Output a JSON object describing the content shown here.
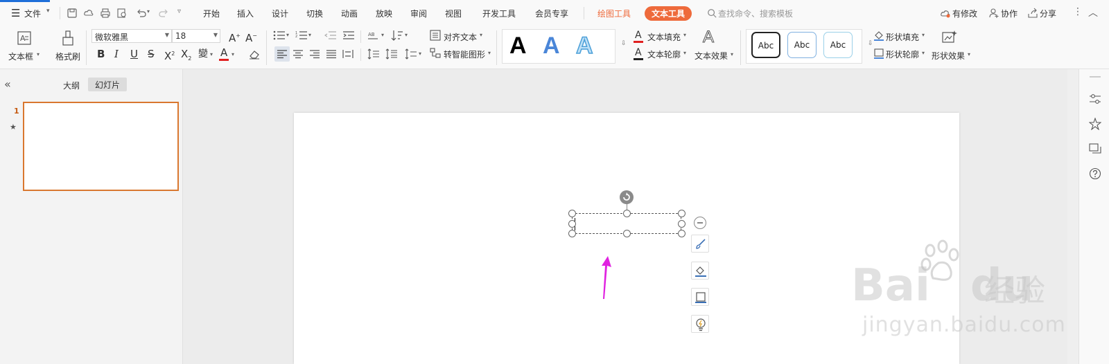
{
  "menu": {
    "file": "文件",
    "tabs": [
      "开始",
      "插入",
      "设计",
      "切换",
      "动画",
      "放映",
      "审阅",
      "视图",
      "开发工具",
      "会员专享"
    ],
    "drawing_tools": "绘图工具",
    "text_tools": "文本工具",
    "search_placeholder": "查找命令、搜索模板",
    "has_changes": "有修改",
    "collaborate": "协作",
    "share": "分享"
  },
  "ribbon": {
    "textbox": "文本框",
    "format_painter": "格式刷",
    "font_name": "微软雅黑",
    "font_size": "18",
    "align_text": "对齐文本",
    "smart_shape": "转智能图形",
    "text_fill": "文本填充",
    "text_outline": "文本轮廓",
    "text_effect": "文本效果",
    "shape_fill": "形状填充",
    "shape_outline": "形状轮廓",
    "shape_effect": "形状效果",
    "wordart_sample": "A",
    "style_samples": [
      "Abc",
      "Abc",
      "Abc"
    ],
    "bold": "B",
    "italic": "I",
    "underline": "U",
    "strike": "S"
  },
  "panel": {
    "outline_tab": "大纲",
    "slides_tab": "幻灯片",
    "slide_number": "1"
  },
  "watermark": {
    "brand": "Bai",
    "brand_tail": "du",
    "cn": "经验",
    "url": "jingyan.baidu.com"
  },
  "colors": {
    "accent": "#ee6a3b",
    "slide_border": "#d9772f",
    "arrow": "#e022e0"
  }
}
